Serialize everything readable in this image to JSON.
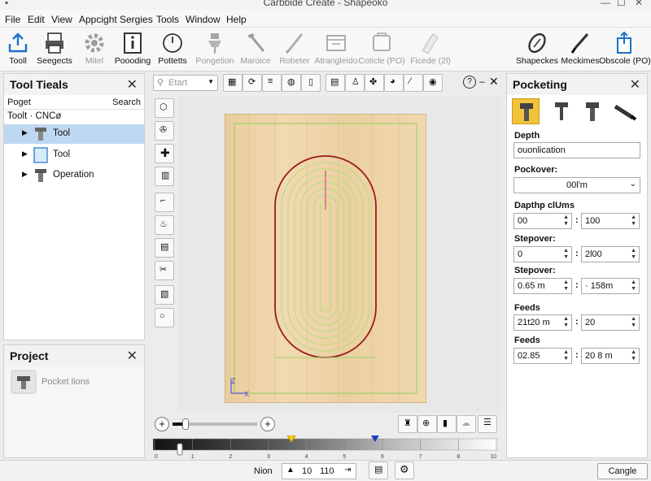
{
  "window": {
    "title": "Carbbide Create - Shapeoko",
    "controls": [
      "—",
      "☐",
      "✕"
    ]
  },
  "menu": [
    "File",
    "Edit",
    "View",
    "Appcight",
    "Sergies",
    "Tools",
    "Window",
    "Help"
  ],
  "toolbar": {
    "left": [
      {
        "label": "Tooll",
        "icon": "upload-icon",
        "dim": false
      },
      {
        "label": "Seegects",
        "icon": "printer-icon",
        "dim": false
      },
      {
        "label": "Mitel",
        "icon": "gear-icon",
        "dim": true
      },
      {
        "label": "Poooding",
        "icon": "info-icon",
        "dim": false
      },
      {
        "label": "Pottetts",
        "icon": "clock-icon",
        "dim": false
      },
      {
        "label": "Pongetion",
        "icon": "probe-icon",
        "dim": true
      },
      {
        "label": "Maroice",
        "icon": "hammer-icon",
        "dim": true
      },
      {
        "label": "Robeter",
        "icon": "brush-icon",
        "dim": true
      },
      {
        "label": "Atrangleido",
        "icon": "window-icon",
        "dim": true
      },
      {
        "label": "Coticle (PO)",
        "icon": "box-icon",
        "dim": true
      },
      {
        "label": "Ficede (2l)",
        "icon": "layers-icon",
        "dim": true
      }
    ],
    "right": [
      {
        "label": "Shapeckes",
        "icon": "shape-icon"
      },
      {
        "label": "Meckimes",
        "icon": "knife-icon"
      },
      {
        "label": "Obscole (PO)",
        "icon": "export-icon"
      }
    ]
  },
  "tool_panel": {
    "title": "Tool Tieals",
    "close": "✕",
    "header": {
      "left": "Poget",
      "right": "Search"
    },
    "root": "Toolt · CNCø",
    "items": [
      {
        "label": "Tool",
        "selected": true,
        "icon": "endmill-icon"
      },
      {
        "label": "Tool",
        "selected": false,
        "icon": "file-icon"
      },
      {
        "label": "Operation",
        "selected": false,
        "icon": "endmill-icon"
      }
    ]
  },
  "project_panel": {
    "title": "Project",
    "close": "✕",
    "item": "Pocket lions"
  },
  "canvas_toolbar": {
    "search_placeholder": "Etart",
    "help": "?",
    "minimize": "–",
    "close": "✕"
  },
  "canvas": {
    "axis_z": "Z",
    "axis_x": "X"
  },
  "zoom": {
    "minus": "+",
    "plus": "+",
    "level": 0.15
  },
  "timeline": {
    "ticks": [
      "0",
      "1",
      "2",
      "3",
      "4",
      "5",
      "6",
      "7",
      "8",
      "10"
    ],
    "yellow_marker": 0.4,
    "blue_marker": 0.645
  },
  "pocketing": {
    "title": "Pocketing",
    "close": "✕",
    "depth_label": "Depth",
    "depth_value": "ouonlication",
    "pockover_label": "Pockover:",
    "pockover_value": "00l'm",
    "depth_columns_label": "Dapthp clUms",
    "depth_a": "00",
    "depth_b": "100",
    "stepover1_label": "Stepover:",
    "step_a": "0",
    "step_b": "2l00",
    "stepover2_label": "Stepover:",
    "step2_a": "0.65 m",
    "step2_b": "· 158m",
    "feeds1_label": "Feeds",
    "feeds_a": "21t20 m",
    "feeds_b": "20",
    "feeds2_label": "Feeds",
    "feeds2_a": "02.85",
    "feeds2_b": "20 8 m"
  },
  "status": {
    "label": "Nion",
    "from": "10",
    "to": "110",
    "cancel": "Cangle"
  },
  "colors": {
    "accent": "#1a73c8",
    "toolpath": "#9cd16a",
    "outline": "#9a1b1b",
    "wood": "#ecd2a6",
    "selected_row": "#bfd8f2"
  }
}
